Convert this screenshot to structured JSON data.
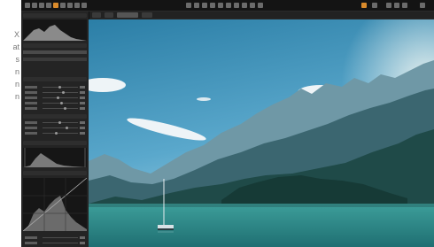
{
  "caption_fragments": [
    "X",
    "at",
    "s",
    "n",
    "n",
    "n"
  ],
  "colors": {
    "app_bg": "#1b1b1b",
    "panel_bg": "#242424",
    "accent": "#d98a2b",
    "sky_top": "#2a7fa6",
    "sky_bottom": "#8ec6de",
    "water": "#2f8c8c"
  },
  "toolbar": {
    "left_icons": [
      "cursor-icon",
      "crop-icon",
      "rotate-icon",
      "brush-icon",
      "eraser-icon",
      "picker-icon",
      "hand-icon",
      "zoom-icon",
      "text-icon"
    ],
    "center_icons": [
      "undo-icon",
      "redo-icon",
      "reset-icon",
      "copy-icon",
      "paste-icon",
      "compare-icon",
      "before-after-icon",
      "grid-icon",
      "proof-icon",
      "export-icon"
    ],
    "right_icons": [
      "warning-icon",
      "settings-icon",
      "help-icon",
      "share-icon"
    ]
  },
  "sidebar": {
    "sections": [
      "histogram",
      "exposure",
      "levels",
      "curve"
    ]
  }
}
